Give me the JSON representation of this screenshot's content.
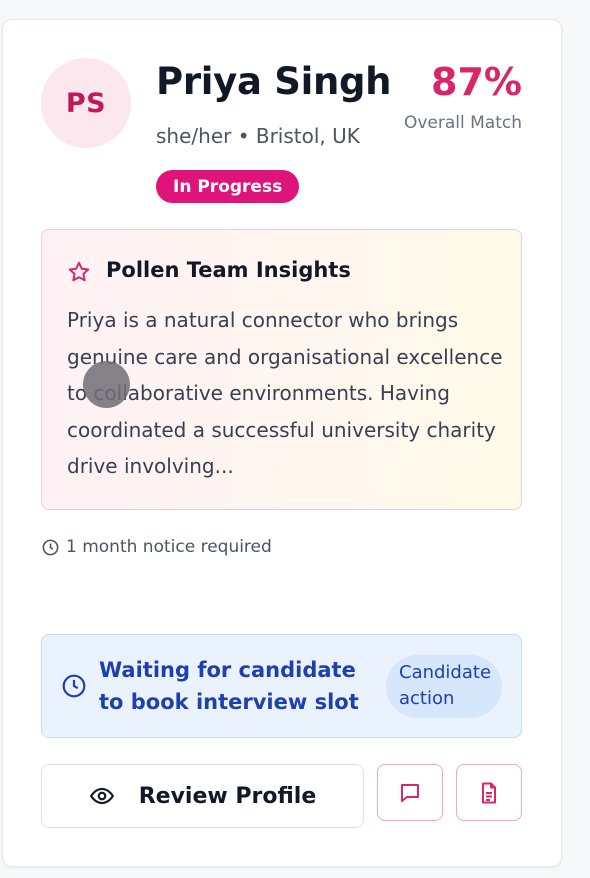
{
  "candidate": {
    "initials": "PS",
    "name": "Priya Singh",
    "meta": "she/her • Bristol, UK",
    "status": "In Progress",
    "match_percent": "87%",
    "match_label": "Overall Match",
    "progress_value": 87
  },
  "insights": {
    "icon": "star-icon",
    "title": "Pollen Team Insights",
    "text": "Priya is a natural connector who brings genuine care and organisational excellence to collaborative environments. Having coordinated a successful university charity drive involving..."
  },
  "notice": {
    "icon": "clock-icon",
    "text": "1 month notice required"
  },
  "waiting": {
    "icon": "clock-icon",
    "text": "Waiting for candidate to book interview slot",
    "badge": "Candidate action"
  },
  "actions": {
    "review_label": "Review Profile",
    "review_icon": "eye-icon",
    "message_icon": "message-icon",
    "document_icon": "document-icon"
  },
  "colors": {
    "accent": "#e0137a",
    "match": "#d9266a",
    "info": "#1e40af"
  }
}
